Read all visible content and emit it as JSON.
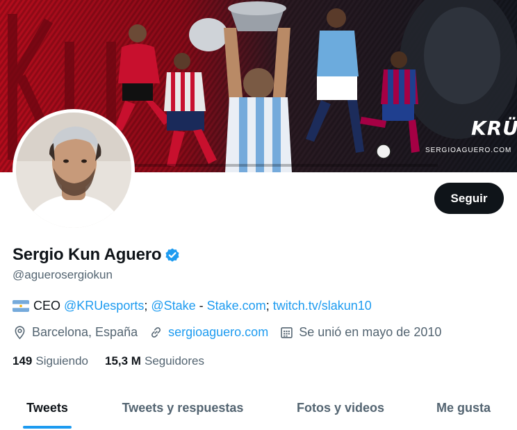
{
  "banner": {
    "brand_mark": "KRÜ",
    "website_caption": "SERGIOAGUERO.COM",
    "colors": {
      "red": "#c8102e",
      "dark": "#1a1c22",
      "sky_blue": "#6cabdd",
      "barca_blue": "#1f3f8f",
      "barca_red": "#a50044"
    }
  },
  "profile": {
    "display_name": "Sergio Kun Aguero",
    "handle": "@aguerosergiokun",
    "verified": true,
    "verified_color": "#1d9bf0"
  },
  "follow_button": {
    "label": "Seguir"
  },
  "bio": {
    "flag_icon": "argentina-flag-icon",
    "ceo": "CEO ",
    "link_kru": "@KRUesports",
    "sep1": "; ",
    "link_stake_handle": "@Stake",
    "sep2": " - ",
    "link_stake_site": "Stake.com",
    "sep3": "; ",
    "link_twitch": "twitch.tv/slakun10"
  },
  "meta": {
    "location_icon": "location-pin-icon",
    "location": "Barcelona, España",
    "website_icon": "link-icon",
    "website": "sergioaguero.com",
    "joined_icon": "calendar-icon",
    "joined": "Se unió en mayo de 2010"
  },
  "stats": {
    "following_count": "149",
    "following_label": "Siguiendo",
    "followers_count": "15,3 M",
    "followers_label": "Seguidores"
  },
  "tabs": [
    {
      "label": "Tweets",
      "active": true
    },
    {
      "label": "Tweets y respuestas",
      "active": false
    },
    {
      "label": "Fotos y videos",
      "active": false
    },
    {
      "label": "Me gusta",
      "active": false
    }
  ],
  "colors": {
    "text_primary": "#0f1419",
    "text_secondary": "#536471",
    "accent": "#1d9bf0"
  }
}
